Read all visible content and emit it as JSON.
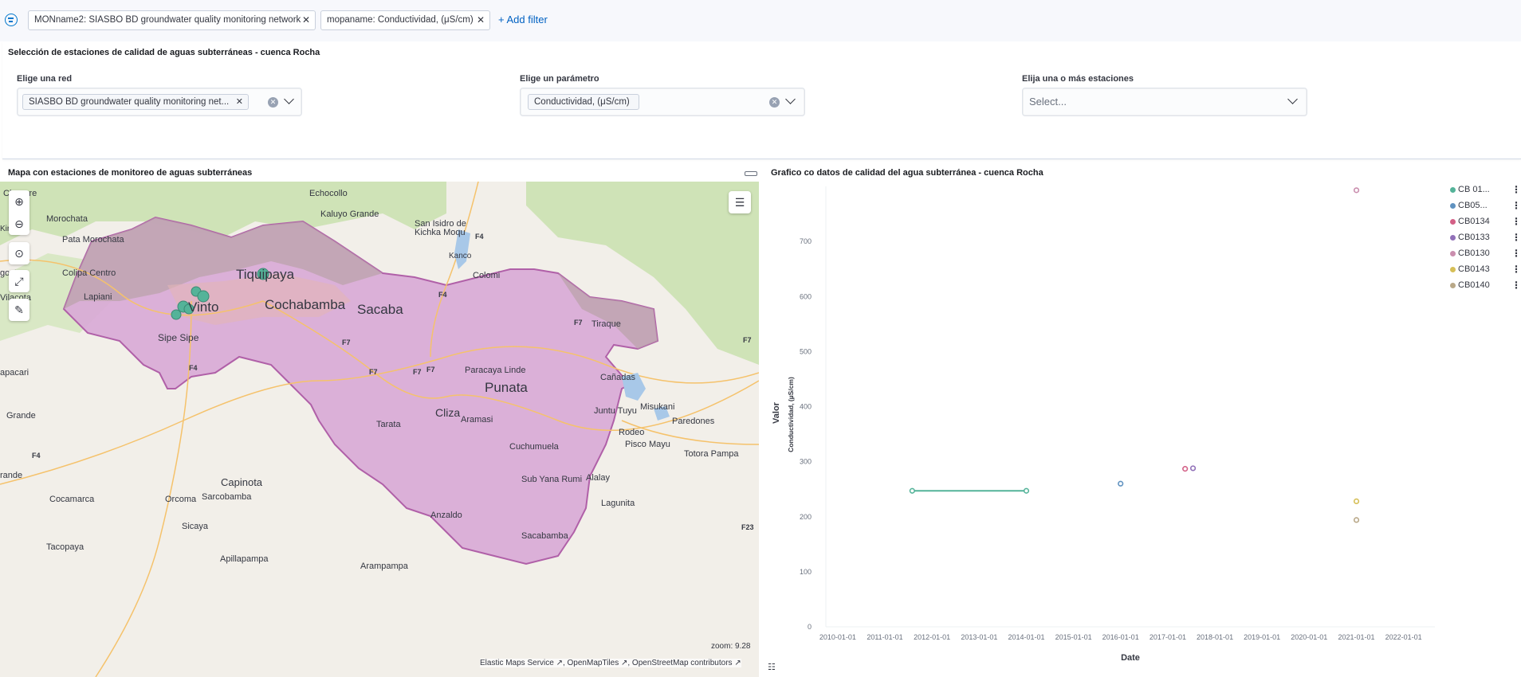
{
  "filter_bar": {
    "pills": [
      {
        "label": "MONname2: SIASBO BD groundwater quality monitoring network"
      },
      {
        "label": "mopaname: Conductividad, (μS/cm)"
      }
    ],
    "add_filter_label": "+ Add filter"
  },
  "selection_panel": {
    "title": "Selección de estaciones de calidad de aguas subterráneas - cuenca Rocha",
    "controls": [
      {
        "label": "Elige una red",
        "selected": "SIASBO BD groundwater quality monitoring net..."
      },
      {
        "label": "Elige un parámetro",
        "selected": "Conductividad, (μS/cm)"
      },
      {
        "label": "Elija una o más estaciones",
        "placeholder": "Select..."
      }
    ]
  },
  "map_panel": {
    "title": "Mapa con estaciones de monitoreo de aguas subterráneas",
    "zoom_text": "zoom: 9.28",
    "attribution": [
      "Elastic Maps Service",
      "OpenMapTiles",
      "OpenStreetMap contributors"
    ],
    "place_labels": [
      "Chapare",
      "Echocollo",
      "Kaluyo Grande",
      "Morochata",
      "San Isidro de",
      "Kichka Moqu",
      "Kiri Kiri",
      "Pata Morochata",
      "Kanco",
      "Colipa Centro",
      "Tiquipaya",
      "Colomi",
      "Lapiani",
      "Cochabamba",
      "Sacaba",
      "Vinto",
      "Vilacota",
      "Tiraque",
      "Sipe Sipe",
      "Paracaya Linde",
      "Cañadas",
      "Punata",
      "Juntu Tuyu",
      "Misukani",
      "Cliza",
      "Aramasi",
      "Paredones",
      "Tarata",
      "Rodeo",
      "Pisco Mayu",
      "Cuchumuela",
      "Totora Pampa",
      "Grande",
      "Sub Yana Rumi",
      "Alalay",
      "Capinota",
      "Cocamarca",
      "Orcoma",
      "Sarcobamba",
      "Lagunita",
      "Sicaya",
      "Anzaldo",
      "Tacopaya",
      "Sacabamba",
      "Apillapampa",
      "Arampampa",
      "gostura",
      "apacari",
      "rande"
    ],
    "road_labels": [
      "F4",
      "F4",
      "F4",
      "F7",
      "F7",
      "F7",
      "F7",
      "F7",
      "F4",
      "F7",
      "F23"
    ],
    "station_color": "#54b399",
    "basin_fill": "#d8a9d6",
    "basin_stroke": "#b060a8"
  },
  "chart_panel": {
    "title": "Grafico co datos de calidad del agua subterránea - cuenca Rocha"
  },
  "chart_data": {
    "type": "scatter",
    "title": "",
    "xlabel": "Date",
    "ylabel": "Valor",
    "ylabel_secondary": "Conductividad, (µS/cm)",
    "x_ticks": [
      "2010-01-01",
      "2011-01-01",
      "2012-01-01",
      "2013-01-01",
      "2014-01-01",
      "2015-01-01",
      "2016-01-01",
      "2017-01-01",
      "2018-01-01",
      "2019-01-01",
      "2020-01-01",
      "2021-01-01",
      "2022-01-01"
    ],
    "y_ticks": [
      0,
      100,
      200,
      300,
      400,
      500,
      600,
      700
    ],
    "ylim": [
      0,
      800
    ],
    "xlim": [
      "2009-10-01",
      "2022-09-01"
    ],
    "legend_position": "right",
    "series": [
      {
        "name": "CB 01...",
        "color": "#54b399",
        "points": [
          [
            "2011-08-01",
            247
          ],
          [
            "2014-01-01",
            247
          ]
        ],
        "line": true
      },
      {
        "name": "CB05...",
        "color": "#6092c0",
        "points": [
          [
            "2016-01-01",
            260
          ]
        ]
      },
      {
        "name": "CB0134",
        "color": "#d36086",
        "points": [
          [
            "2017-05-15",
            287
          ]
        ]
      },
      {
        "name": "CB0133",
        "color": "#9170b8",
        "points": [
          [
            "2017-07-15",
            288
          ]
        ]
      },
      {
        "name": "CB0130",
        "color": "#ca8eae",
        "points": [
          [
            "2021-01-01",
            793
          ]
        ]
      },
      {
        "name": "CB0143",
        "color": "#d6bf57",
        "points": [
          [
            "2021-01-01",
            228
          ]
        ]
      },
      {
        "name": "CB0140",
        "color": "#b9a888",
        "points": [
          [
            "2021-01-01",
            194
          ]
        ]
      }
    ]
  }
}
